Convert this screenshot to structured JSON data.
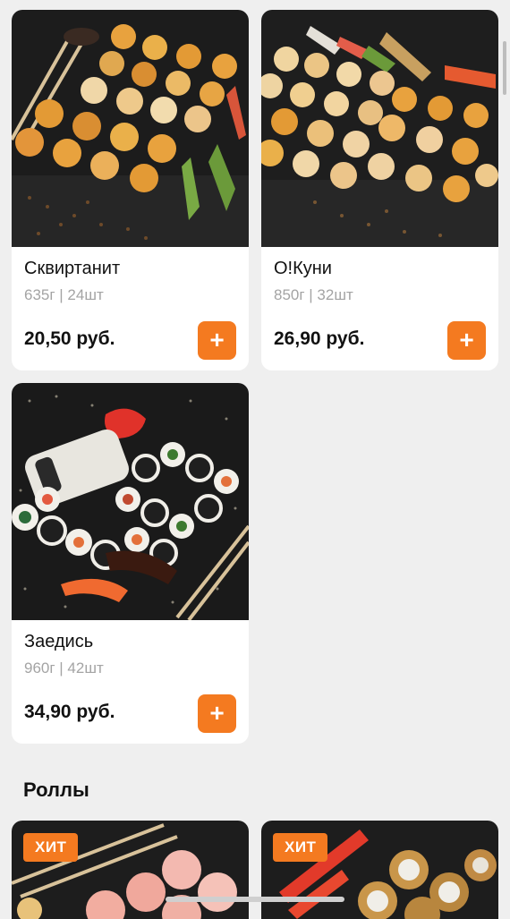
{
  "products": [
    {
      "name": "Сквиртанит",
      "meta": "635г | 24шт",
      "price": "20,50 руб.",
      "add_label": "+"
    },
    {
      "name": "О!Куни",
      "meta": "850г | 32шт",
      "price": "26,90 руб.",
      "add_label": "+"
    },
    {
      "name": "Заедись",
      "meta": "960г | 42шт",
      "price": "34,90 руб.",
      "add_label": "+"
    }
  ],
  "sections": {
    "rolls_title": "Роллы"
  },
  "rolls": [
    {
      "badge": "ХИТ"
    },
    {
      "badge": "ХИТ"
    }
  ],
  "colors": {
    "accent": "#f47a20",
    "background": "#efefef",
    "card": "#ffffff",
    "meta_text": "#a4a4a4"
  }
}
